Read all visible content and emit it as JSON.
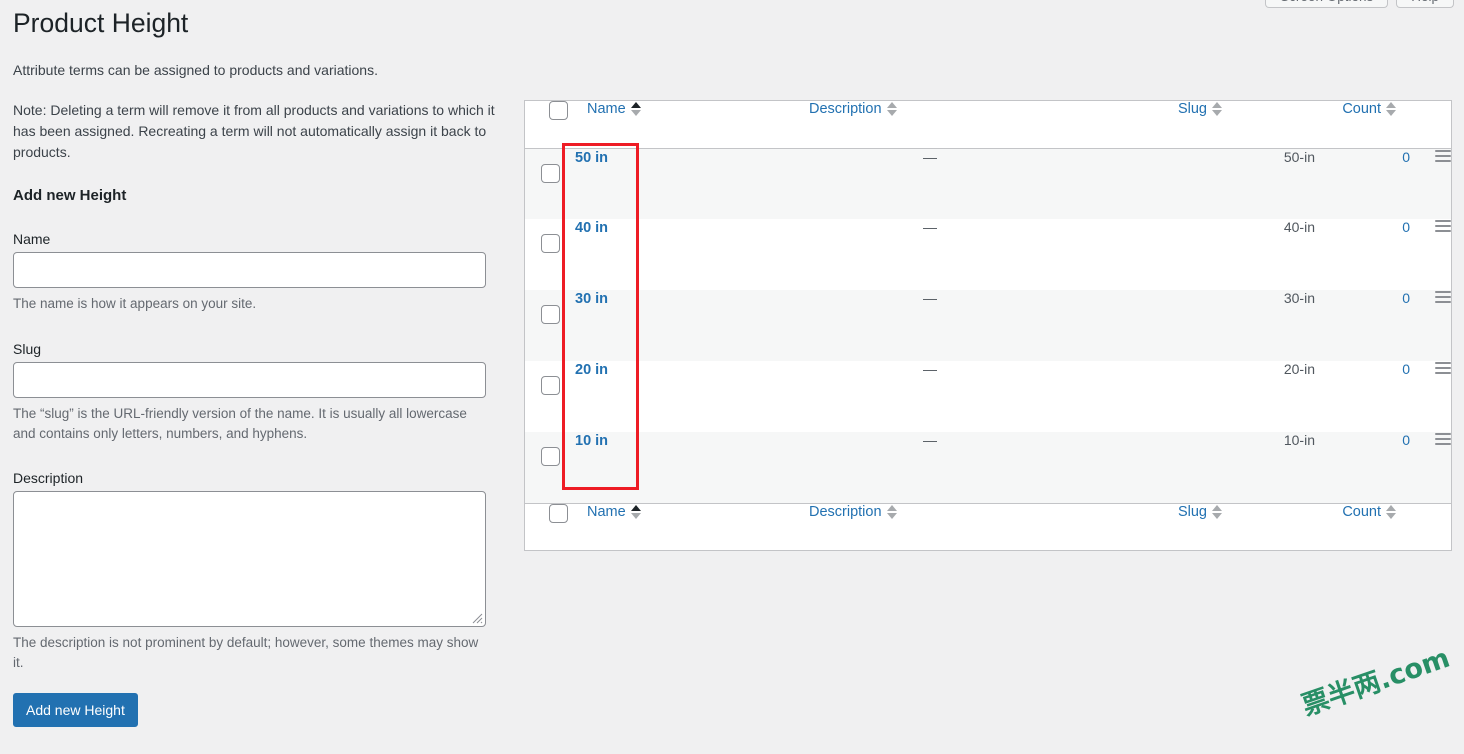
{
  "window": {
    "screen_options_label": "Screen Options",
    "help_label": "Help"
  },
  "page": {
    "title": "Product Height",
    "intro": "Attribute terms can be assigned to products and variations.",
    "note": "Note: Deleting a term will remove it from all products and variations to which it has been assigned. Recreating a term will not automatically assign it back to products."
  },
  "form": {
    "section_title": "Add new Height",
    "name_label": "Name",
    "name_value": "",
    "name_help": "The name is how it appears on your site.",
    "slug_label": "Slug",
    "slug_value": "",
    "slug_help": "The “slug” is the URL-friendly version of the name. It is usually all lowercase and contains only letters, numbers, and hyphens.",
    "description_label": "Description",
    "description_value": "",
    "description_help": "The description is not prominent by default; however, some themes may show it.",
    "submit_label": "Add new Height"
  },
  "table": {
    "columns": {
      "name": "Name",
      "description": "Description",
      "slug": "Slug",
      "count": "Count"
    },
    "sorted_by": "name",
    "sort_direction": "asc",
    "rows": [
      {
        "name": "50 in",
        "description": "—",
        "slug": "50-in",
        "count": "0"
      },
      {
        "name": "40 in",
        "description": "—",
        "slug": "40-in",
        "count": "0"
      },
      {
        "name": "30 in",
        "description": "—",
        "slug": "30-in",
        "count": "0"
      },
      {
        "name": "20 in",
        "description": "—",
        "slug": "20-in",
        "count": "0"
      },
      {
        "name": "10 in",
        "description": "—",
        "slug": "10-in",
        "count": "0"
      }
    ]
  },
  "watermark": {
    "text": "票半两.com",
    "color": "#1e8a5f"
  },
  "colors": {
    "accent_blue": "#2271b1",
    "page_bg": "#f0f0f1",
    "row_alt_bg": "#f6f7f7",
    "border": "#c3c4c7",
    "annotation_red": "#ee1c25"
  }
}
